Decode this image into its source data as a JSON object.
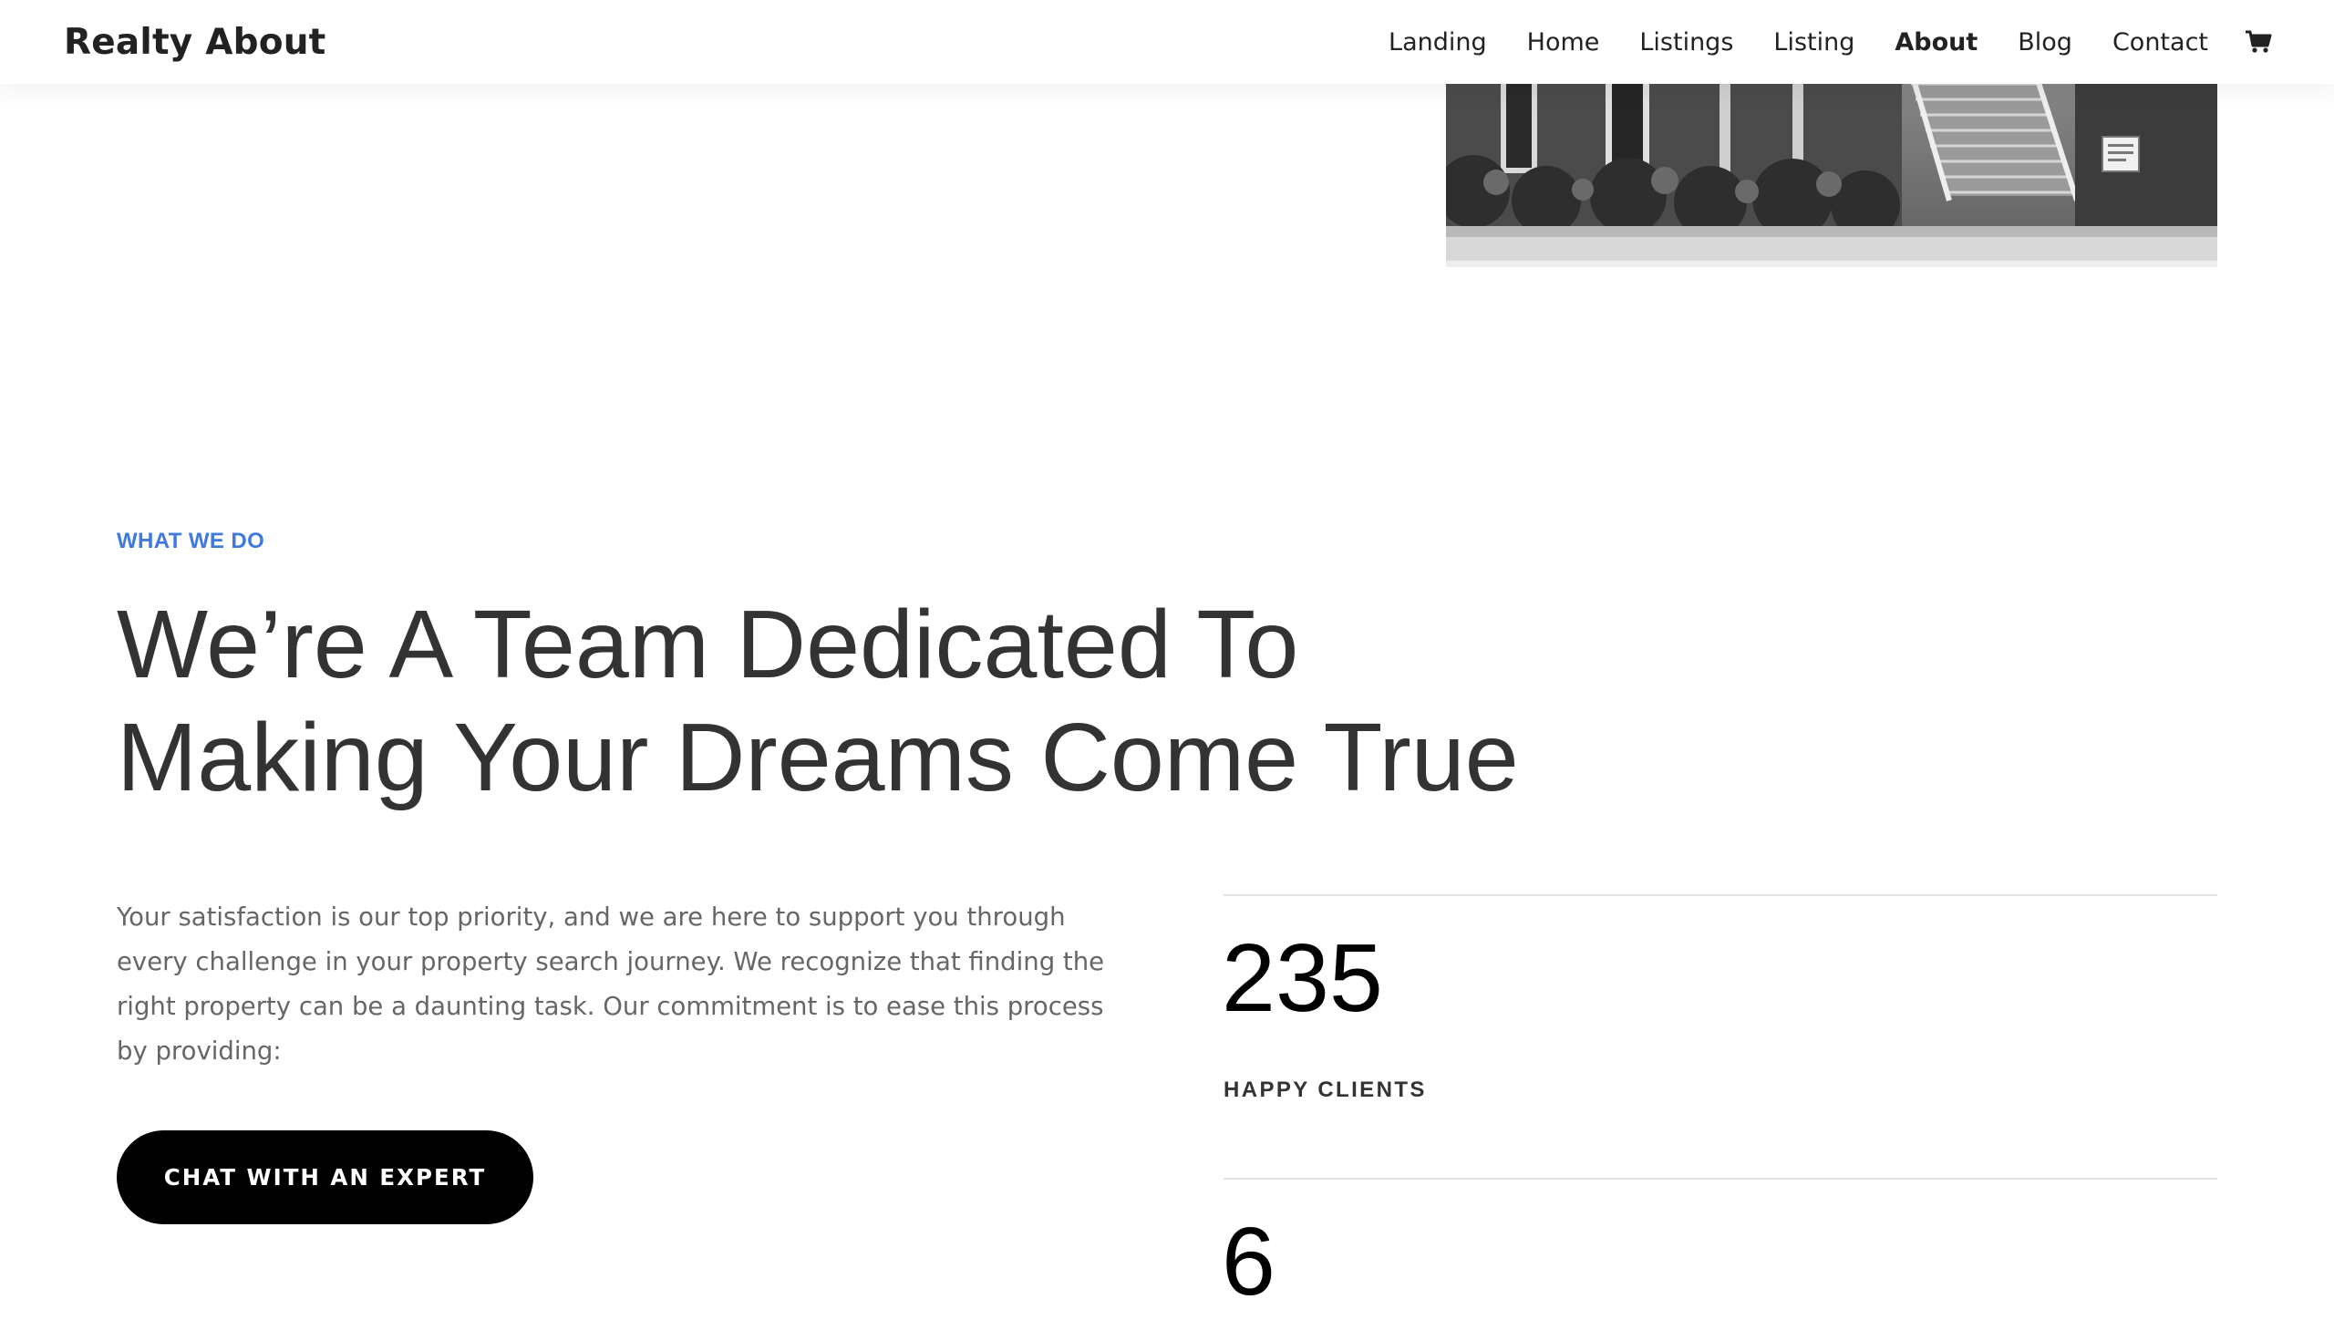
{
  "header": {
    "brand": "Realty About",
    "nav": [
      {
        "label": "Landing",
        "active": false
      },
      {
        "label": "Home",
        "active": false
      },
      {
        "label": "Listings",
        "active": false
      },
      {
        "label": "Listing",
        "active": false
      },
      {
        "label": "About",
        "active": true
      },
      {
        "label": "Blog",
        "active": false
      },
      {
        "label": "Contact",
        "active": false
      }
    ],
    "cart_icon": "shopping-cart-icon"
  },
  "hero": {
    "image": "house-photo-grayscale"
  },
  "section": {
    "eyebrow": "WHAT WE DO",
    "headline_line1": "We’re A Team Dedicated To",
    "headline_line2": "Making Your Dreams Come True",
    "body": "Your satisfaction is our top priority, and we are here to support you through every challenge in your property search journey. We recognize that finding the right property can be a daunting task. Our commitment is to ease this process by providing:",
    "cta_label": "CHAT WITH AN EXPERT"
  },
  "stats": [
    {
      "number": "235",
      "label": "HAPPY CLIENTS"
    },
    {
      "number": "6",
      "label": ""
    }
  ],
  "colors": {
    "accent": "#3f78e0",
    "heading": "#333333",
    "body": "#666666",
    "button_bg": "#000000",
    "button_text": "#ffffff"
  }
}
